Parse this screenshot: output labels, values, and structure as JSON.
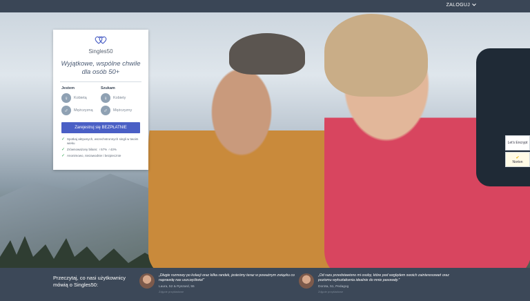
{
  "topbar": {
    "login_label": "ZALOGUJ"
  },
  "card": {
    "brand": "Singles50",
    "tagline": "Wyjątkowe, wspólne chwile dla osób 50+",
    "i_am": {
      "heading": "Jestem",
      "options": [
        "Kobietą",
        "Mężczyzną"
      ]
    },
    "looking_for": {
      "heading": "Szukam",
      "options": [
        "Kobiety",
        "Mężczyzny"
      ]
    },
    "cta_label": "Zarejestruj się BEZPŁATNIE",
    "benefits": [
      "Spotkaj aktywnych, wszechstronnych singli w twoim wieku",
      "Zrównoważony bilans: ♀57% ♂43%",
      "Anonimowo, niezawodnie i bezpiecznie"
    ]
  },
  "badges": {
    "lets_encrypt": "Let's Encrypt",
    "norton": "Norton"
  },
  "footer": {
    "intro": "Przeczytaj, co nasi użytkownicy mówią o Singles50:",
    "testimonials": [
      {
        "quote": "„Długie rozmowy po kolacji oraz kilka randek, jesteśmy teraz w poważnym związku co naprawdę nas uszczęśliwia!”",
        "author": "Laura, 52 & Ryszard, 55",
        "tag": "Zdjęcie przykładowe"
      },
      {
        "quote": "„Od razu przedstawiono mi osoby, które pod względem swoich zainteresowań oraz poziomu wykształcenia idealnie do mnie pasowały.”",
        "author": "Dorota, 51, Pedagog",
        "tag": "Zdjęcie przykładowe"
      }
    ]
  },
  "colors": {
    "cta": "#4a5fc5",
    "footer": "#3c4858",
    "check": "#2da44e"
  }
}
